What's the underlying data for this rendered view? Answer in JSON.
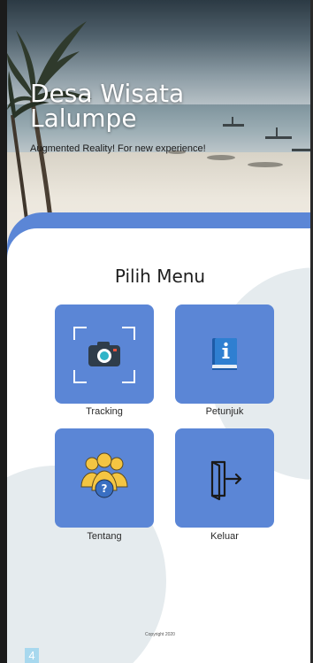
{
  "header": {
    "title_line1": "Desa Wisata",
    "title_line2": "Lalumpe",
    "subtitle": "Augmented Reality! For new experience!"
  },
  "menu": {
    "title": "Pilih Menu",
    "items": [
      {
        "label": "Tracking",
        "icon": "camera-icon"
      },
      {
        "label": "Petunjuk",
        "icon": "info-book-icon"
      },
      {
        "label": "Tentang",
        "icon": "group-question-icon"
      },
      {
        "label": "Keluar",
        "icon": "exit-door-icon"
      }
    ]
  },
  "footer": {
    "copyright": "Copyright 2020"
  },
  "page_badge": "4",
  "colors": {
    "accent": "#5b86d6",
    "background": "#ffffff",
    "blob": "#e5ebee",
    "badge": "#a8d8ee"
  }
}
